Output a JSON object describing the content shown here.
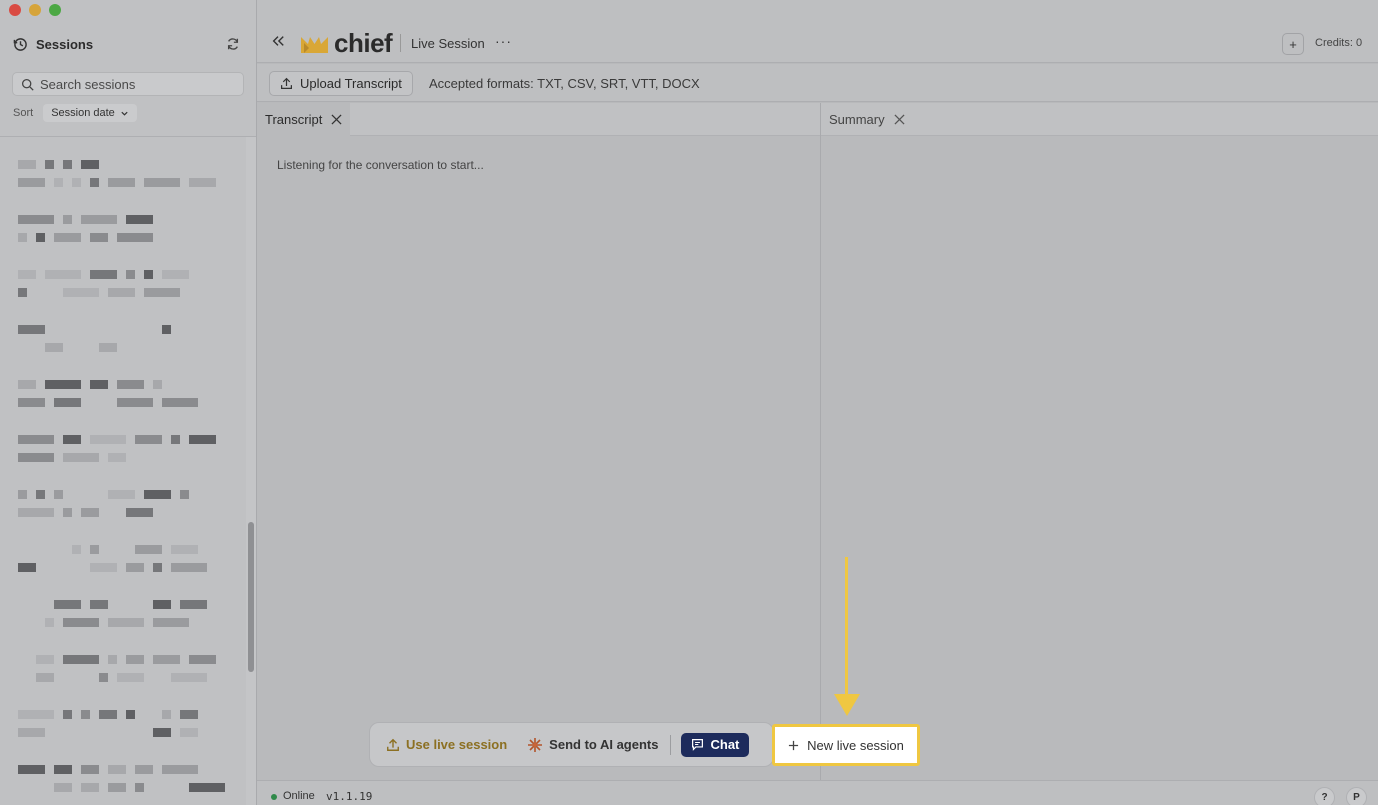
{
  "window": {
    "controls": [
      "close",
      "minimize",
      "zoom"
    ]
  },
  "sidebar": {
    "title": "Sessions",
    "search_placeholder": "Search sessions",
    "sort_label": "Sort",
    "sort_value": "Session date",
    "session_count": 12
  },
  "header": {
    "logo_text": "chief",
    "session_title": "Live Session",
    "more_label": "···",
    "add_label": "+",
    "credits": "Credits: 0"
  },
  "toolbar": {
    "upload_label": "Upload Transcript",
    "formats": "Accepted formats: TXT, CSV, SRT, VTT, DOCX"
  },
  "panels": {
    "transcript_tab": "Transcript",
    "summary_tab": "Summary",
    "listening_text": "Listening for the conversation to start..."
  },
  "actions": {
    "use_live": "Use live session",
    "send_ai": "Send to AI agents",
    "chat": "Chat",
    "new_live": "New live session"
  },
  "status": {
    "online": "Online",
    "version": "v1.1.19",
    "help": "?",
    "profile": "P"
  },
  "colors": {
    "accent_yellow": "#efc741",
    "chat_navy": "#1d2b5c",
    "online_green": "#2f8a4a"
  }
}
